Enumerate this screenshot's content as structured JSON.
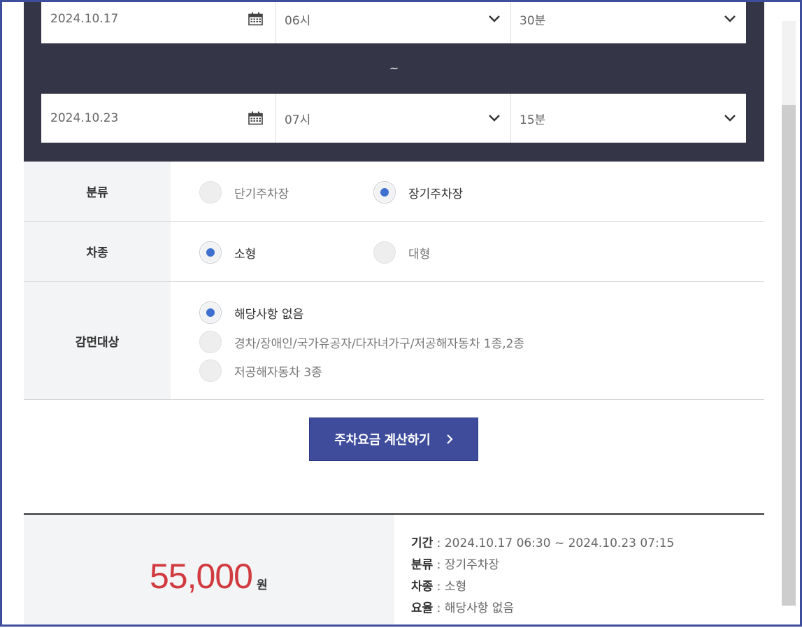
{
  "period": {
    "start": {
      "date": "2024.10.17",
      "hour": "06시",
      "minute": "30분"
    },
    "separator": "~",
    "end": {
      "date": "2024.10.23",
      "hour": "07시",
      "minute": "15분"
    }
  },
  "options": {
    "category": {
      "label": "분류",
      "choices": [
        {
          "label": "단기주차장",
          "selected": false
        },
        {
          "label": "장기주차장",
          "selected": true
        }
      ]
    },
    "vehicle": {
      "label": "차종",
      "choices": [
        {
          "label": "소형",
          "selected": true
        },
        {
          "label": "대형",
          "selected": false
        }
      ]
    },
    "discount": {
      "label": "감면대상",
      "choices": [
        {
          "label": "해당사항 없음",
          "selected": true
        },
        {
          "label": "경차/장애인/국가유공자/다자녀가구/저공해자동차 1종,2종",
          "selected": false
        },
        {
          "label": "저공해자동차 3종",
          "selected": false
        }
      ]
    }
  },
  "calc_button": {
    "label": "주차요금 계산하기"
  },
  "result": {
    "amount": "55,000",
    "unit": "원",
    "details": [
      {
        "key": "기간",
        "value": "2024.10.17 06:30 ~ 2024.10.23 07:15"
      },
      {
        "key": "분류",
        "value": "장기주차장"
      },
      {
        "key": "차종",
        "value": "소형"
      },
      {
        "key": "요율",
        "value": "해당사항 없음"
      }
    ]
  },
  "colors": {
    "panel_bg": "#343648",
    "button_bg": "#3f4c9c",
    "radio_selected": "#3d6fcf",
    "amount": "#d13a3f",
    "frame": "#3f4e9c"
  }
}
